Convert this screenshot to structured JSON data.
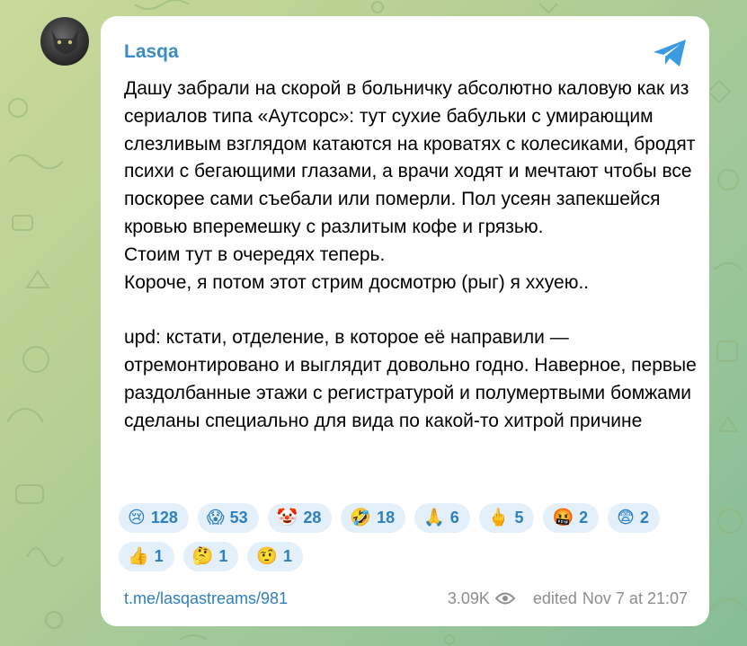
{
  "post": {
    "author": "Lasqa",
    "paragraphs": [
      "Дашу забрали на скорой в больничку абсолютно каловую как из сериалов типа «Аутсорс»: тут сухие бабульки с умирающим слезливым взглядом катаются на кроватях с колесиками, бродят психи с бегающими глазами, а врачи ходят и мечтают чтобы все поскорее сами съебали или померли. Пол усеян запекшейся кровью вперемешку с разлитым кофе и грязью.",
      "Стоим тут в очередях теперь.",
      "Короче, я потом этот стрим досмотрю (рыг) я ххуею..",
      "upd: кстати, отделение, в которое её направили — отремонтировано и выглядит довольно годно. Наверное, первые раздолбанные этажи с регистратурой и полумертвыми бомжами сделаны специально для вида по какой-то хитрой причине"
    ],
    "reactions": [
      {
        "emoji": "😢",
        "count": "128"
      },
      {
        "emoji": "😱",
        "count": "53"
      },
      {
        "emoji": "🤡",
        "count": "28"
      },
      {
        "emoji": "🤣",
        "count": "18"
      },
      {
        "emoji": "🙏",
        "count": "6"
      },
      {
        "emoji": "🖕",
        "count": "5"
      },
      {
        "emoji": "🤬",
        "count": "2"
      },
      {
        "emoji": "😨",
        "count": "2"
      },
      {
        "emoji": "👍",
        "count": "1"
      },
      {
        "emoji": "🤔",
        "count": "1"
      },
      {
        "emoji": "🤨",
        "count": "1"
      }
    ],
    "link": "t.me/lasqastreams/981",
    "views": "3.09K",
    "edited_label": "edited",
    "date": "Nov 7 at 21:07"
  },
  "icons": {
    "share": "telegram-paper-plane-icon",
    "views": "eye-icon"
  },
  "colors": {
    "accent": "#2e7fc0",
    "reaction_bg": "#e3f0fa",
    "share_icon": "#3a9be0"
  }
}
